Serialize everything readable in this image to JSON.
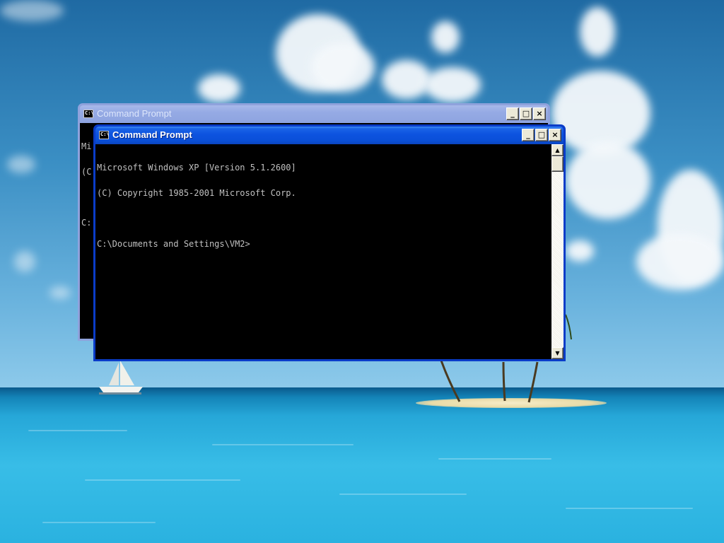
{
  "back_window": {
    "title": "Command Prompt",
    "icon": "cmd-icon",
    "visible_lines": [
      "Mi",
      "(C",
      "",
      "C:"
    ],
    "buttons": {
      "minimize": "_",
      "maximize": "□",
      "close": "×"
    }
  },
  "front_window": {
    "title": "Command Prompt",
    "icon": "cmd-icon",
    "lines": [
      "Microsoft Windows XP [Version 5.1.2600]",
      "(C) Copyright 1985-2001 Microsoft Corp.",
      "",
      "C:\\Documents and Settings\\VM2>"
    ],
    "buttons": {
      "minimize": "_",
      "maximize": "□",
      "close": "×"
    }
  },
  "scroll_arrows": {
    "up": "▲",
    "down": "▼"
  },
  "colors": {
    "active_title": "#0a4fd8",
    "inactive_title": "#95aae4",
    "console_bg": "#000000",
    "console_text": "#c0c0c0"
  }
}
